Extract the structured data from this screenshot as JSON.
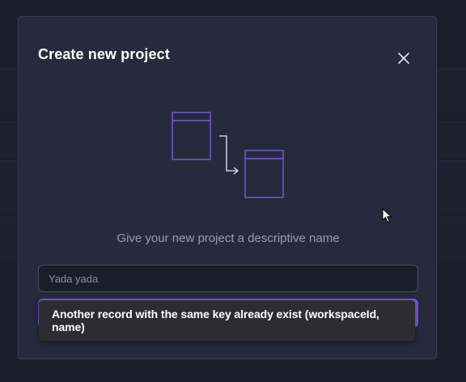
{
  "modal": {
    "title": "Create new project",
    "close_icon": "close-icon",
    "illustration_icon": "tables-link-illustration",
    "description": "Give your new project a descriptive name",
    "name_input": {
      "value": "",
      "placeholder": "Yada yada"
    },
    "create_button_label": ""
  },
  "toast": {
    "message": "Another record with the same key already exist (workspaceId, name)"
  },
  "colors": {
    "accent": "#7b5cd6",
    "modal_bg": "#262a3c",
    "page_bg": "#1c1e2c",
    "toast_bg": "#2d2d31"
  }
}
